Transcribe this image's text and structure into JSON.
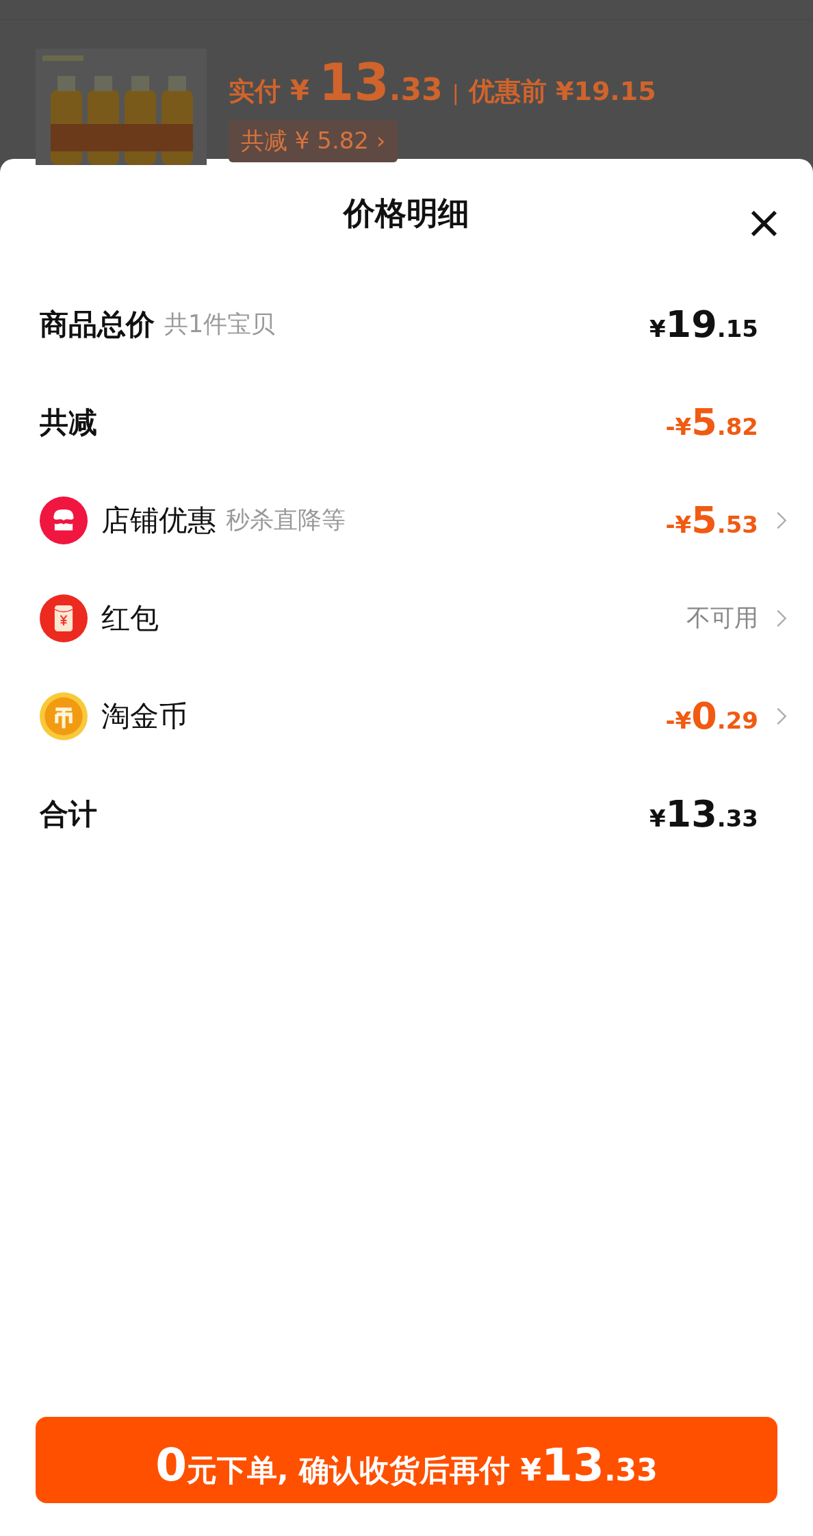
{
  "background_order": {
    "paid_label": "实付",
    "paid_currency": "¥",
    "paid_main": "13",
    "paid_fraction": ".33",
    "separator": "|",
    "original_price": "优惠前 ¥19.15",
    "reduction_chip": "共减 ¥ 5.82",
    "chip_chevron": "›"
  },
  "sheet": {
    "title": "价格明细",
    "close": "×",
    "rows": [
      {
        "kind": "plain",
        "label": "商品总价",
        "note": "共1件宝贝",
        "amount": {
          "currency": "¥",
          "main": "19",
          "fraction": ".15"
        },
        "chevron": false
      },
      {
        "kind": "plain",
        "label": "共减",
        "amount": {
          "sign": "-",
          "currency": "¥",
          "main": "5",
          "fraction": ".82"
        },
        "chevron": false
      },
      {
        "kind": "shop",
        "label": "店铺优惠",
        "note": "秒杀直降等",
        "amount": {
          "sign": "-",
          "currency": "¥",
          "main": "5",
          "fraction": ".53"
        },
        "chevron": true
      },
      {
        "kind": "envelope",
        "label": "红包",
        "status": "不可用",
        "chevron": true
      },
      {
        "kind": "coin",
        "label": "淘金币",
        "amount": {
          "sign": "-",
          "currency": "¥",
          "main": "0",
          "fraction": ".29"
        },
        "chevron": true
      },
      {
        "kind": "plain",
        "label": "合计",
        "amount": {
          "currency": "¥",
          "main": "13",
          "fraction": ".33"
        },
        "chevron": false
      }
    ],
    "pay_button": {
      "lead": "0",
      "text": "元下单, 确认收货后再付 ",
      "currency": "¥",
      "main": "13",
      "fraction": ".33"
    }
  }
}
